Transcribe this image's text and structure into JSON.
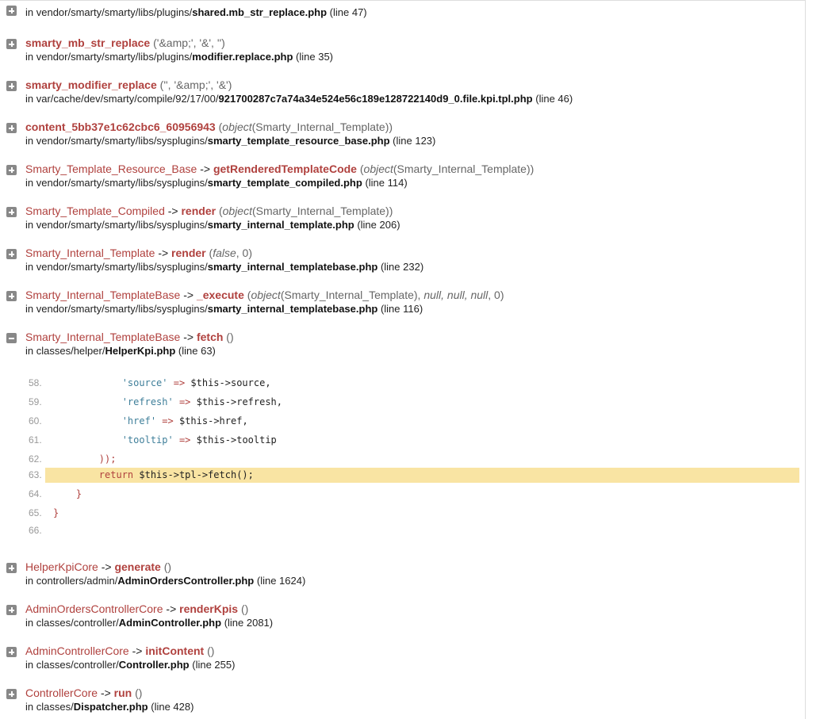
{
  "frames": [
    {
      "cls": "",
      "fn": "",
      "args": "",
      "dir": "in vendor/smarty/smarty/libs/plugins/",
      "file": "shared.mb_str_replace.php",
      "line": "(line 47)"
    },
    {
      "cls": "",
      "fn": "smarty_mb_str_replace",
      "args": "('&amp;', '&', '')",
      "dir": "in vendor/smarty/smarty/libs/plugins/",
      "file": "modifier.replace.php",
      "line": "(line 35)"
    },
    {
      "cls": "",
      "fn": "smarty_modifier_replace",
      "args": "('', '&amp;', '&')",
      "dir": "in var/cache/dev/smarty/compile/92/17/00/",
      "file": "921700287c7a74a34e524e56c189e128722140d9_0.file.kpi.tpl.php",
      "line": "(line 46)"
    },
    {
      "cls": "",
      "fn": "content_5bb37e1c62cbc6_60956943",
      "args_open": "(",
      "args_obj": "object",
      "args_rest": "(Smarty_Internal_Template))",
      "dir": "in vendor/smarty/smarty/libs/sysplugins/",
      "file": "smarty_template_resource_base.php",
      "line": "(line 123)"
    },
    {
      "cls": "Smarty_Template_Resource_Base",
      "fn": "getRenderedTemplateCode",
      "args_open": "(",
      "args_obj": "object",
      "args_rest": "(Smarty_Internal_Template))",
      "dir": "in vendor/smarty/smarty/libs/sysplugins/",
      "file": "smarty_template_compiled.php",
      "line": "(line 114)"
    },
    {
      "cls": "Smarty_Template_Compiled",
      "fn": "render",
      "args_open": "(",
      "args_obj": "object",
      "args_rest": "(Smarty_Internal_Template))",
      "dir": "in vendor/smarty/smarty/libs/sysplugins/",
      "file": "smarty_internal_template.php",
      "line": "(line 206)"
    },
    {
      "cls": "Smarty_Internal_Template",
      "fn": "render",
      "args_open": "(",
      "args_obj": "false",
      "args_rest": ", 0)",
      "dir": "in vendor/smarty/smarty/libs/sysplugins/",
      "file": "smarty_internal_templatebase.php",
      "line": "(line 232)"
    },
    {
      "cls": "Smarty_Internal_TemplateBase",
      "fn": "_execute",
      "args_open": "(",
      "args_obj": "object",
      "args_rest": "(Smarty_Internal_Template), ",
      "args_extra": "null, null, null",
      "args_tail": ", 0)",
      "dir": "in vendor/smarty/smarty/libs/sysplugins/",
      "file": "smarty_internal_templatebase.php",
      "line": "(line 116)"
    },
    {
      "cls": "Smarty_Internal_TemplateBase",
      "fn": "fetch",
      "args": "()",
      "dir": "in classes/helper/",
      "file": "HelperKpi.php",
      "line": "(line 63)"
    },
    {
      "cls": "HelperKpiCore",
      "fn": "generate",
      "args": "()",
      "dir": "in controllers/admin/",
      "file": "AdminOrdersController.php",
      "line": "(line 1624)"
    },
    {
      "cls": "AdminOrdersControllerCore",
      "fn": "renderKpis",
      "args": "()",
      "dir": "in classes/controller/",
      "file": "AdminController.php",
      "line": "(line 2081)"
    },
    {
      "cls": "AdminControllerCore",
      "fn": "initContent",
      "args": "()",
      "dir": "in classes/controller/",
      "file": "Controller.php",
      "line": "(line 255)"
    },
    {
      "cls": "ControllerCore",
      "fn": "run",
      "args": "()",
      "dir": "in classes/",
      "file": "Dispatcher.php",
      "line": "(line 428)"
    }
  ],
  "arrow": "->",
  "code": {
    "lines": [
      {
        "num": "58.",
        "indent": "            ",
        "str": "'source'",
        "op": " => ",
        "rest": "$this->source,"
      },
      {
        "num": "59.",
        "indent": "            ",
        "str": "'refresh'",
        "op": " => ",
        "rest": "$this->refresh,"
      },
      {
        "num": "60.",
        "indent": "            ",
        "str": "'href'",
        "op": " => ",
        "rest": "$this->href,"
      },
      {
        "num": "61.",
        "indent": "            ",
        "str": "'tooltip'",
        "op": " => ",
        "rest": "$this->tooltip"
      },
      {
        "num": "62.",
        "indent": "        ",
        "kw": "));",
        "rest": ""
      },
      {
        "num": "63.",
        "indent": "        ",
        "kw": "return ",
        "rest": "$this->tpl->fetch();"
      },
      {
        "num": "64.",
        "indent": "    ",
        "kw": "}",
        "rest": ""
      },
      {
        "num": "65.",
        "indent": "",
        "kw": "}",
        "rest": ""
      },
      {
        "num": "66.",
        "indent": "",
        "kw": "",
        "rest": ""
      }
    ]
  }
}
